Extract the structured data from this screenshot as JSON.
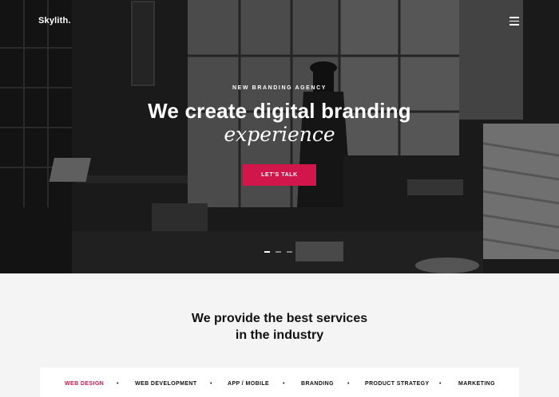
{
  "brand": {
    "logo": "Skylith."
  },
  "hero": {
    "eyebrow": "NEW BRANDING AGENCY",
    "headline": "We create digital branding",
    "headline_italic": "experience",
    "cta_label": "LET'S TALK",
    "slides": {
      "count": 3,
      "active": 1
    }
  },
  "services": {
    "title_line1": "We provide the best services",
    "title_line2": "in the industry",
    "tabs": [
      {
        "label": "WEB DESIGN",
        "active": true
      },
      {
        "label": "WEB DEVELOPMENT",
        "active": false
      },
      {
        "label": "APP / MOBILE",
        "active": false
      },
      {
        "label": "BRANDING",
        "active": false
      },
      {
        "label": "PRODUCT STRATEGY",
        "active": false
      },
      {
        "label": "MARKETING",
        "active": false
      }
    ],
    "separator": "•"
  },
  "colors": {
    "accent": "#d0164a",
    "page_bg": "#f4f4f4",
    "hero_dark": "#1a1a1a"
  },
  "icons": {
    "menu": "hamburger-menu-icon"
  }
}
